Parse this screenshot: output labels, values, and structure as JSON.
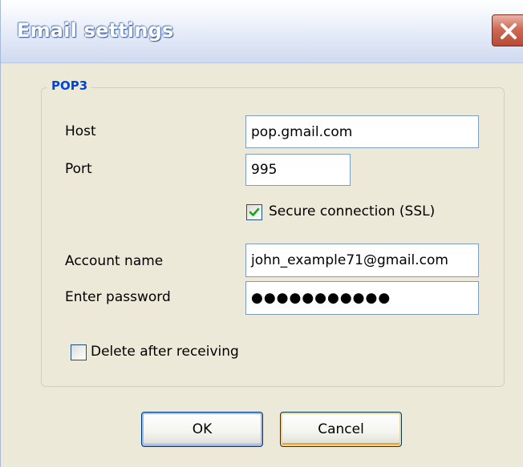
{
  "window": {
    "title": "Email settings",
    "close_icon": "close-icon"
  },
  "pop3": {
    "legend": "POP3",
    "host_label": "Host",
    "host_value": "pop.gmail.com",
    "port_label": "Port",
    "port_value": "995",
    "ssl_label": "Secure connection (SSL)",
    "ssl_checked": true,
    "account_label": "Account name",
    "account_value": "john_example71@gmail.com",
    "password_label": "Enter password",
    "password_value": "●●●●●●●●●●●",
    "delete_label": "Delete after receiving",
    "delete_checked": false
  },
  "buttons": {
    "ok_label": "OK",
    "cancel_label": "Cancel"
  },
  "colors": {
    "dialog_background": "#ECE9D8",
    "legend_text": "#0046d5",
    "checkmark": "#21a121",
    "close_button": "#c8553c"
  }
}
